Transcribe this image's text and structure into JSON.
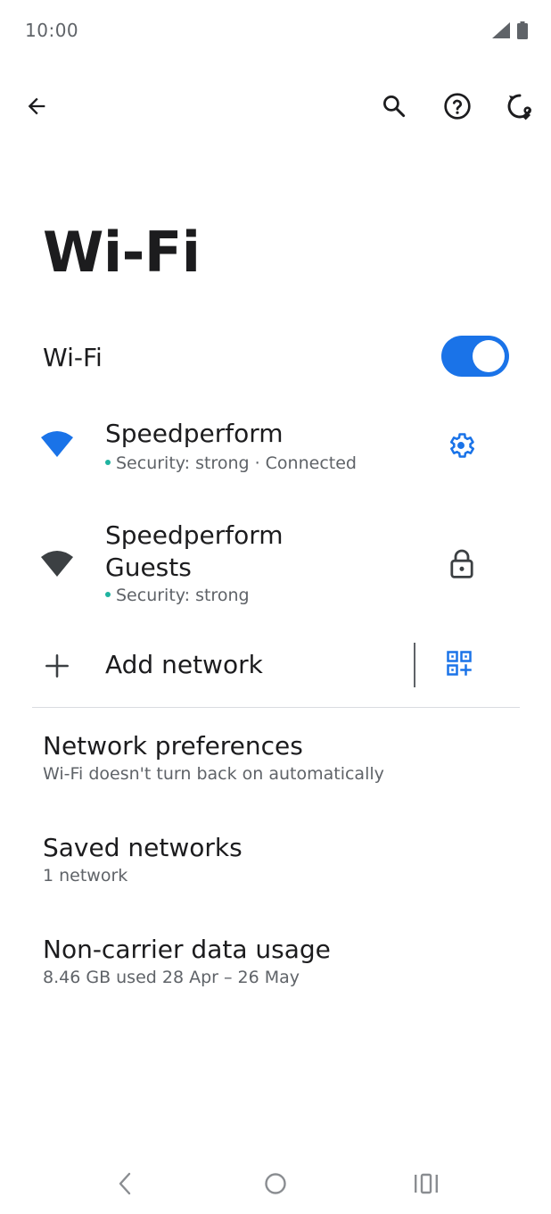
{
  "status_bar": {
    "time": "10:00"
  },
  "page": {
    "title": "Wi-Fi"
  },
  "wifi_toggle": {
    "label": "Wi-Fi",
    "enabled": true
  },
  "networks": [
    {
      "name": "Speedperform",
      "status": "Security: strong · Connected",
      "action_icon": "gear-icon"
    },
    {
      "name_line1": "Speedperform",
      "name_line2": "Guests",
      "status": "Security: strong",
      "action_icon": "lock-icon"
    }
  ],
  "add_network": {
    "label": "Add network"
  },
  "preferences": [
    {
      "title": "Network preferences",
      "subtitle": "Wi-Fi doesn't turn back on automatically"
    },
    {
      "title": "Saved networks",
      "subtitle": "1 network"
    },
    {
      "title": "Non-carrier data usage",
      "subtitle": "8.46 GB used 28 Apr – 26 May"
    }
  ],
  "colors": {
    "accent": "#1a73e8",
    "connected_wifi": "#1a73e8",
    "other_wifi": "#3c4043",
    "status_dot": "#1fb3a0",
    "secondary_text": "#5f6368"
  }
}
